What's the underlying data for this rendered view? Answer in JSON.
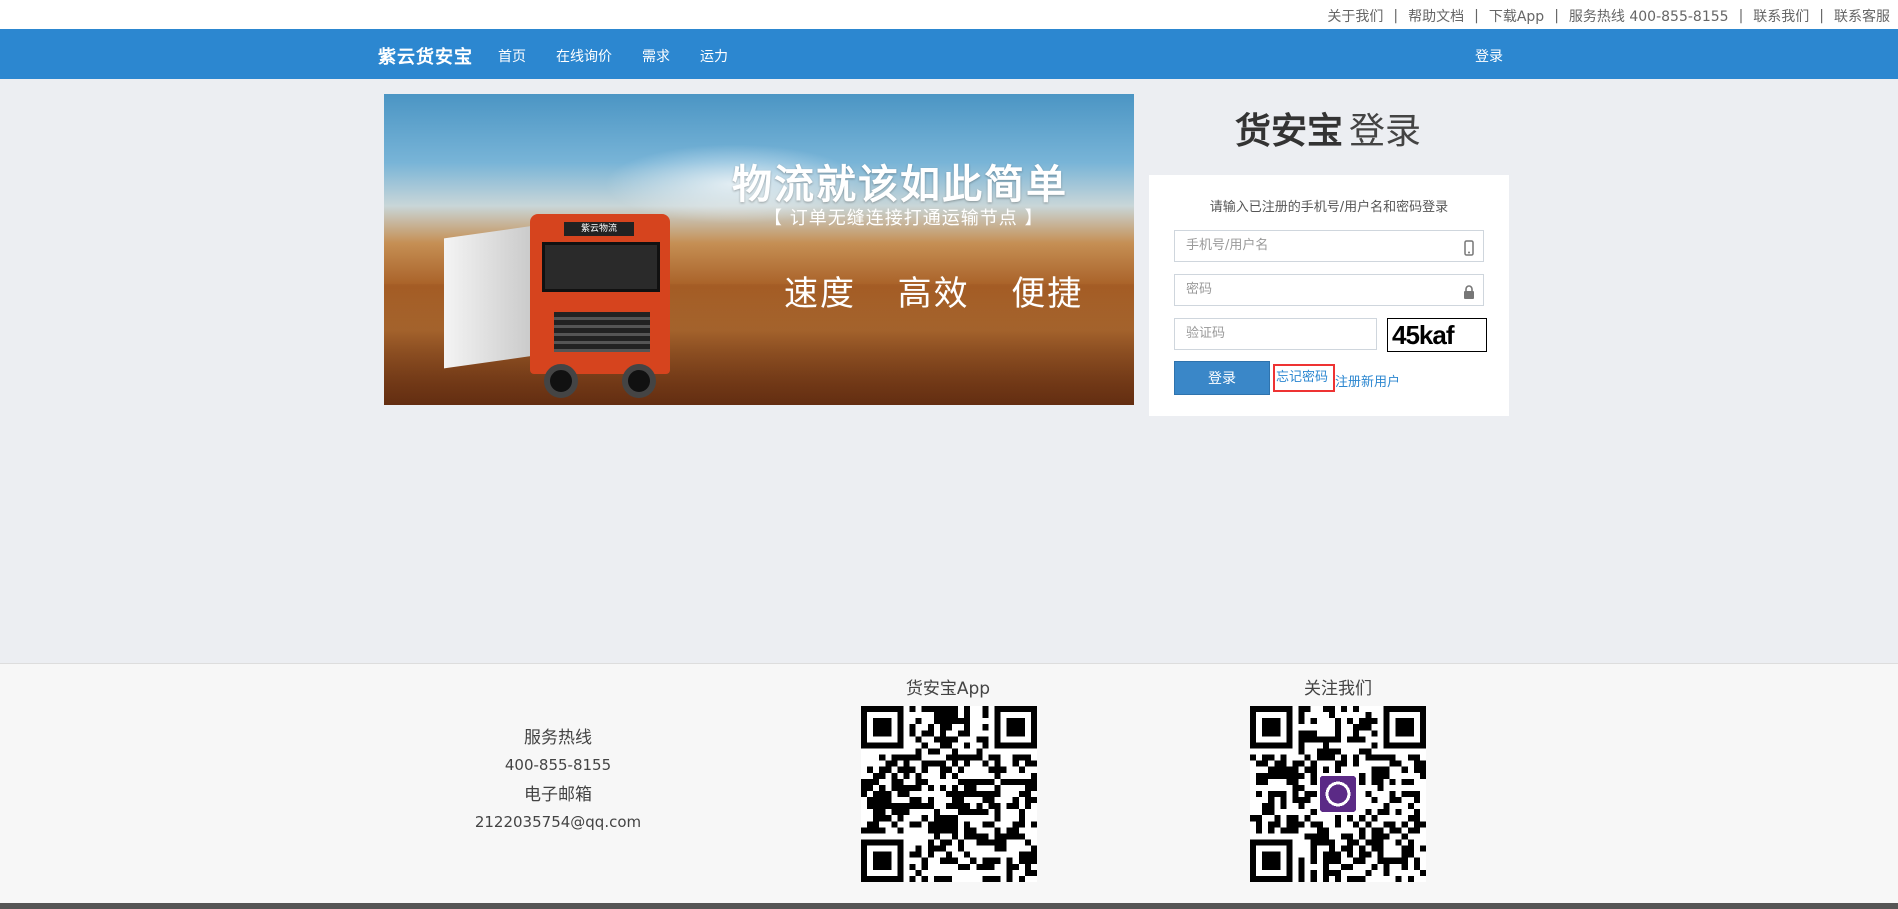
{
  "topbar": {
    "links": [
      "关于我们",
      "帮助文档",
      "下载App",
      "服务热线 400-855-8155",
      "联系我们",
      "联系客服"
    ]
  },
  "nav": {
    "brand": "紫云货安宝",
    "items": [
      "首页",
      "在线询价",
      "需求",
      "运力"
    ],
    "login": "登录"
  },
  "banner": {
    "headline": "物流就该如此简单",
    "subline": "【 订单无缝连接打通运输节点 】",
    "slogan": "速度  高效  便捷",
    "truck_sign": "紫云物流"
  },
  "login": {
    "title_bold": "货安宝",
    "title_light": "登录",
    "tip": "请输入已注册的手机号/用户名和密码登录",
    "username_placeholder": "手机号/用户名",
    "password_placeholder": "密码",
    "captcha_placeholder": "验证码",
    "captcha_text": "45kaf",
    "submit": "登录",
    "forgot": "忘记密码",
    "register": "注册新用户"
  },
  "footer": {
    "hotline_label": "服务热线",
    "hotline": "400-855-8155",
    "email_label": "电子邮箱",
    "email": "2122035754@qq.com",
    "app_label": "货安宝App",
    "follow_label": "关注我们"
  },
  "colors": {
    "nav_bg": "#2c87d0",
    "button": "#3a87c8",
    "link": "#2c87d0",
    "highlight": "#e33333"
  }
}
